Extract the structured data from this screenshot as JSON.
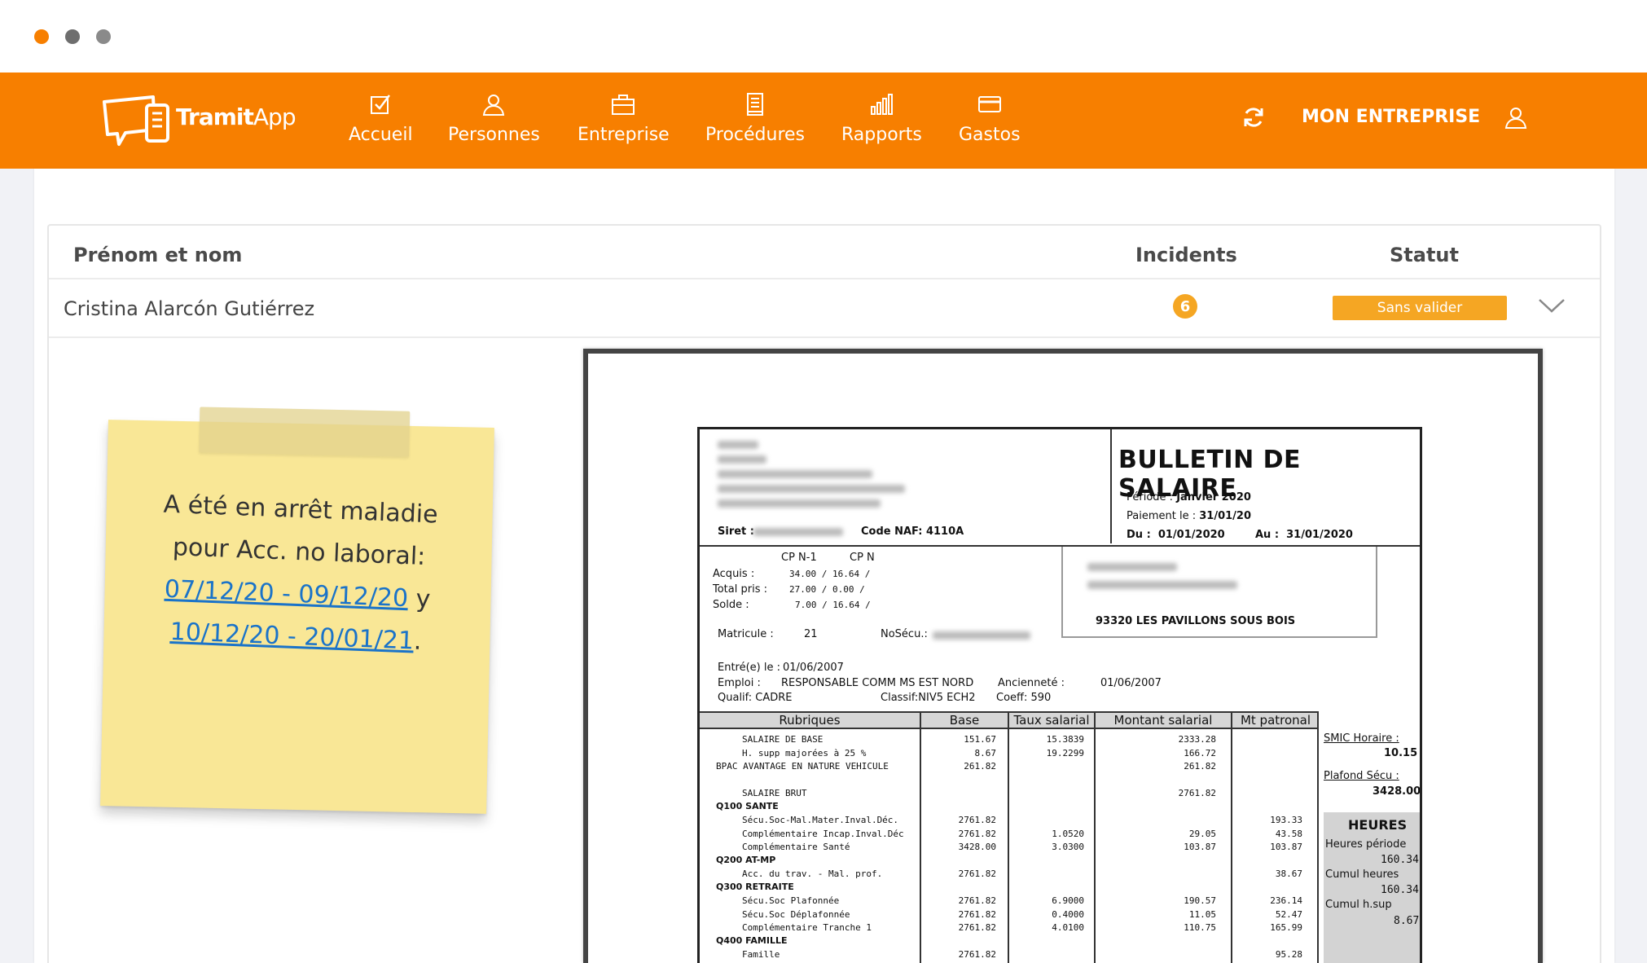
{
  "window": {
    "dots": [
      "#f77f00",
      "#777777",
      "#888888"
    ]
  },
  "brand": {
    "name_bold": "Tramit",
    "name_regular": "App"
  },
  "nav": {
    "items": [
      {
        "label": "Accueil",
        "icon": "checkbox-icon"
      },
      {
        "label": "Personnes",
        "icon": "person-icon"
      },
      {
        "label": "Entreprise",
        "icon": "briefcase-icon"
      },
      {
        "label": "Procédures",
        "icon": "document-icon"
      },
      {
        "label": "Rapports",
        "icon": "bar-chart-icon"
      },
      {
        "label": "Gastos",
        "icon": "credit-card-icon"
      }
    ],
    "company_label": "MON ENTREPRISE",
    "accent": "#f77f00"
  },
  "table": {
    "headers": {
      "name": "Prénom et nom",
      "incidents": "Incidents",
      "status": "Statut"
    },
    "row": {
      "name": "Cristina Alarcón Gutiérrez",
      "incidents": "6",
      "status": "Sans valider",
      "status_color": "#f5a623"
    }
  },
  "note": {
    "line1": "A été en arrêt maladie",
    "line2": "pour Acc. no laboral:",
    "range1": "07/12/20 - 09/12/20",
    "conj": " y",
    "range2": "10/12/20 - 20/01/21",
    "end": "."
  },
  "payslip": {
    "title": "BULLETIN DE SALAIRE",
    "periode_label": "Période :",
    "periode_value": "Janvier 2020",
    "paiement_label": "Paiement le :",
    "paiement_value": "31/01/20",
    "du_label": "Du :",
    "du_value": "01/01/2020",
    "au_label": "Au :",
    "au_value": "31/01/2020",
    "siret_label": "Siret :",
    "naf": "Code NAF: 4110A",
    "cp_n1": "CP N-1",
    "cp_n": "CP N",
    "acquis": "Acquis :",
    "acquis_v": "34.00  /   16.64  /",
    "total": "Total pris :",
    "total_v": "27.00  /    0.00  /",
    "solde": "Solde :",
    "solde_v": "7.00  /   16.64  /",
    "matricule_label": "Matricule :",
    "matricule": "21",
    "nosecu_label": "NoSécu.:",
    "address": "93320  LES PAVILLONS SOUS BOIS",
    "entree_label": "Entré(e) le :",
    "entree": "01/06/2007",
    "emploi_label": "Emploi :",
    "emploi": "RESPONSABLE COMM MS EST NORD",
    "anciennete_label": "Ancienneté :",
    "anciennete": "01/06/2007",
    "qualif": "Qualif:  CADRE",
    "classif": "Classif:NIV5 ECH2",
    "coeff": "Coeff: 590",
    "cols": [
      "Rubriques",
      "Base",
      "Taux salarial",
      "Montant salarial",
      "Mt patronal"
    ],
    "lines": [
      {
        "r": "SALAIRE DE BASE",
        "b": "151.67",
        "t": "15.3839",
        "m": "2333.28",
        "p": "",
        "indent": 1,
        "bold": false
      },
      {
        "r": "H. supp majorées à 25 %",
        "b": "8.67",
        "t": "19.2299",
        "m": "166.72",
        "p": "",
        "indent": 1,
        "bold": false
      },
      {
        "r": "BPAC AVANTAGE EN NATURE VEHICULE",
        "b": "261.82",
        "t": "",
        "m": "261.82",
        "p": "",
        "indent": 0,
        "bold": false
      },
      {
        "r": "",
        "b": "",
        "t": "",
        "m": "",
        "p": "",
        "indent": 0,
        "bold": false
      },
      {
        "r": "SALAIRE BRUT",
        "b": "",
        "t": "",
        "m": "2761.82",
        "p": "",
        "indent": 1,
        "bold": false
      },
      {
        "r": "Q100 SANTE",
        "b": "",
        "t": "",
        "m": "",
        "p": "",
        "indent": 0,
        "bold": true
      },
      {
        "r": "Sécu.Soc-Mal.Mater.Inval.Déc.",
        "b": "2761.82",
        "t": "",
        "m": "",
        "p": "193.33",
        "indent": 1,
        "bold": false
      },
      {
        "r": "Complémentaire Incap.Inval.Déc",
        "b": "2761.82",
        "t": "1.0520",
        "m": "29.05",
        "p": "43.58",
        "indent": 1,
        "bold": false
      },
      {
        "r": "Complémentaire Santé",
        "b": "3428.00",
        "t": "3.0300",
        "m": "103.87",
        "p": "103.87",
        "indent": 1,
        "bold": false
      },
      {
        "r": "Q200 AT-MP",
        "b": "",
        "t": "",
        "m": "",
        "p": "",
        "indent": 0,
        "bold": true
      },
      {
        "r": "Acc. du trav. - Mal. prof.",
        "b": "2761.82",
        "t": "",
        "m": "",
        "p": "38.67",
        "indent": 1,
        "bold": false
      },
      {
        "r": "Q300 RETRAITE",
        "b": "",
        "t": "",
        "m": "",
        "p": "",
        "indent": 0,
        "bold": true
      },
      {
        "r": "Sécu.Soc Plafonnée",
        "b": "2761.82",
        "t": "6.9000",
        "m": "190.57",
        "p": "236.14",
        "indent": 1,
        "bold": false
      },
      {
        "r": "Sécu.Soc Déplafonnée",
        "b": "2761.82",
        "t": "0.4000",
        "m": "11.05",
        "p": "52.47",
        "indent": 1,
        "bold": false
      },
      {
        "r": "Complémentaire Tranche 1",
        "b": "2761.82",
        "t": "4.0100",
        "m": "110.75",
        "p": "165.99",
        "indent": 1,
        "bold": false
      },
      {
        "r": "Q400 FAMILLE",
        "b": "",
        "t": "",
        "m": "",
        "p": "",
        "indent": 0,
        "bold": true
      },
      {
        "r": "Famille",
        "b": "2761.82",
        "t": "",
        "m": "",
        "p": "95.28",
        "indent": 1,
        "bold": false
      }
    ],
    "smic_label": "SMIC Horaire :",
    "smic": "10.15",
    "plafond_label": "Plafond Sécu :",
    "plafond": "3428.00",
    "heures_title": "HEURES",
    "hp_label": "Heures période",
    "hp": "160.34",
    "ch_label": "Cumul heures",
    "ch": "160.34",
    "chs_label": "Cumul h.sup",
    "chs": "8.67"
  }
}
